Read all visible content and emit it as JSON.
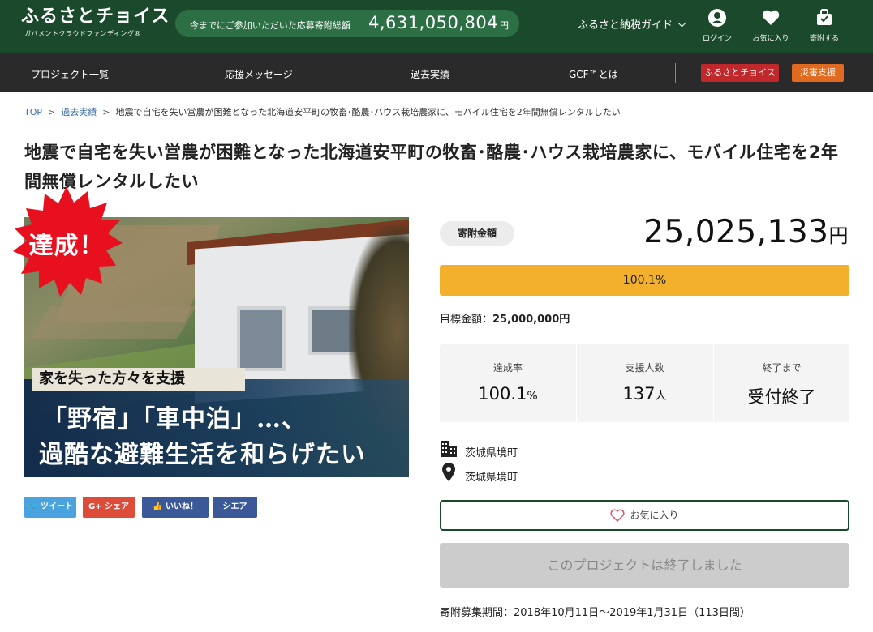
{
  "header": {
    "logo_main": "ふるさとチョイス",
    "logo_sub": "ガバメントクラウドファンディング®",
    "total_label": "今までにご参加いただいた応募寄附総額",
    "total_value": "4,631,050,804",
    "total_unit": "円",
    "guide_label": "ふるさと納税ガイド",
    "icons": [
      {
        "name": "user-icon",
        "label": "ログイン"
      },
      {
        "name": "heart-icon",
        "label": "お気に入り"
      },
      {
        "name": "gift-icon",
        "label": "寄附する"
      }
    ],
    "colors": {
      "bg": "#1a4a2b",
      "pill": "#2d6f45"
    }
  },
  "nav": {
    "items": [
      "プロジェクト一覧",
      "応援メッセージ",
      "過去実績",
      "GCF™とは"
    ],
    "buttons": [
      {
        "label": "ふるさとチョイス",
        "color": "#c0282b"
      },
      {
        "label": "災害支援",
        "color": "#e06a20"
      }
    ]
  },
  "breadcrumb": {
    "top": "TOP",
    "past": "過去実績",
    "current": "地震で自宅を失い営農が困難となった北海道安平町の牧畜･酪農･ハウス栽培農家に、モバイル住宅を2年間無償レンタルしたい"
  },
  "title": "地震で自宅を失い営農が困難となった北海道安平町の牧畜･酪農･ハウス栽培農家に、モバイル住宅を2年間無償レンタルしたい",
  "hero": {
    "badge": "達成！",
    "tag": "家を失った方々を支援",
    "line1": "「野宿」「車中泊」…、",
    "line2": "過酷な避難生活を和らげたい"
  },
  "share": [
    {
      "label": "ツイート",
      "icon": "twitter-icon",
      "color": "#4aa3df"
    },
    {
      "label": "シェア",
      "icon": "googleplus-icon",
      "prefix": "G+",
      "color": "#dd4b39"
    },
    {
      "label": "いいね！",
      "icon": "thumbs-up-icon",
      "color": "#3b5998"
    },
    {
      "label": "シエア",
      "icon": "",
      "color": "#3b5998"
    }
  ],
  "funding": {
    "label": "寄附金額",
    "amount": "25,025,133",
    "unit": "円",
    "progress_text": "100.1%",
    "progress_percent": 100.1,
    "progress_color": "#f2b02c",
    "goal_label": "目標金額：",
    "goal_value": "25,000,000円"
  },
  "stats": [
    {
      "label": "達成率",
      "value": "100.1",
      "unit": "%"
    },
    {
      "label": "支援人数",
      "value": "137",
      "unit": "人"
    },
    {
      "label": "終了まで",
      "value": "受付終了",
      "unit": ""
    }
  ],
  "info": {
    "organizer": "茨城県境町",
    "location": "茨城県境町"
  },
  "actions": {
    "favorite": "お気に入り",
    "ended": "このプロジェクトは終了しました"
  },
  "period": "寄附募集期間：2018年10月11日〜2019年1月31日（113日間）"
}
